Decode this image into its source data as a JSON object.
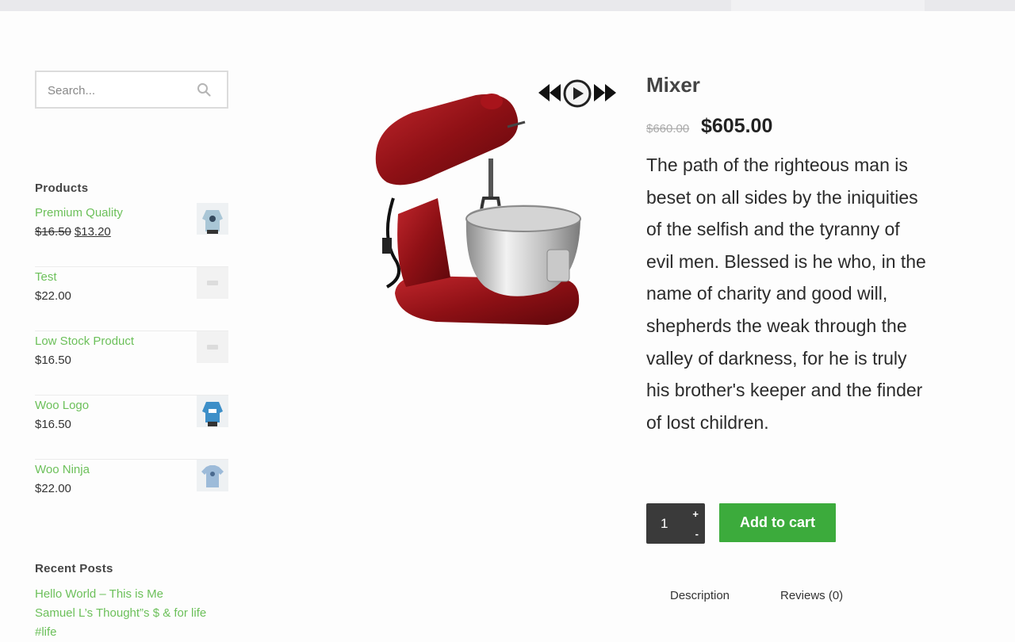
{
  "search": {
    "placeholder": "Search..."
  },
  "products_widget": {
    "title": "Products",
    "items": [
      {
        "name": "Premium Quality",
        "price_old": "$16.50",
        "price": "$13.20",
        "thumb": "hoodie-thumb"
      },
      {
        "name": "Test",
        "price": "$22.00",
        "thumb": "placeholder-thumb"
      },
      {
        "name": "Low Stock Product",
        "price": "$16.50",
        "thumb": "placeholder-thumb"
      },
      {
        "name": "Woo Logo",
        "price": "$16.50",
        "thumb": "woo-hoodie-thumb"
      },
      {
        "name": "Woo Ninja",
        "price": "$22.00",
        "thumb": "tshirt-thumb"
      }
    ]
  },
  "recent_posts": {
    "title": "Recent Posts",
    "items": [
      "Hello World – This is Me",
      "Samuel L’s Thought”s $ & for life",
      "#life"
    ]
  },
  "product": {
    "title": "Mixer",
    "price_old": "$660.00",
    "price": "$605.00",
    "description": "The path of the righteous man is beset on all sides by the iniquities of the selfish and the tyranny of evil men. Blessed is he who, in the name of charity and good will, shepherds the weak through the valley of darkness, for he is truly his brother's keeper and the finder of lost children.",
    "quantity": "1",
    "qty_plus": "+",
    "qty_minus": "-",
    "add_to_cart": "Add to cart",
    "image": "stand-mixer-image"
  },
  "tabs": [
    {
      "label": "Description"
    },
    {
      "label": "Reviews (0)"
    }
  ],
  "colors": {
    "link": "#6cc05a",
    "button": "#3cab3c",
    "qty_bg": "#3a3a3a"
  }
}
